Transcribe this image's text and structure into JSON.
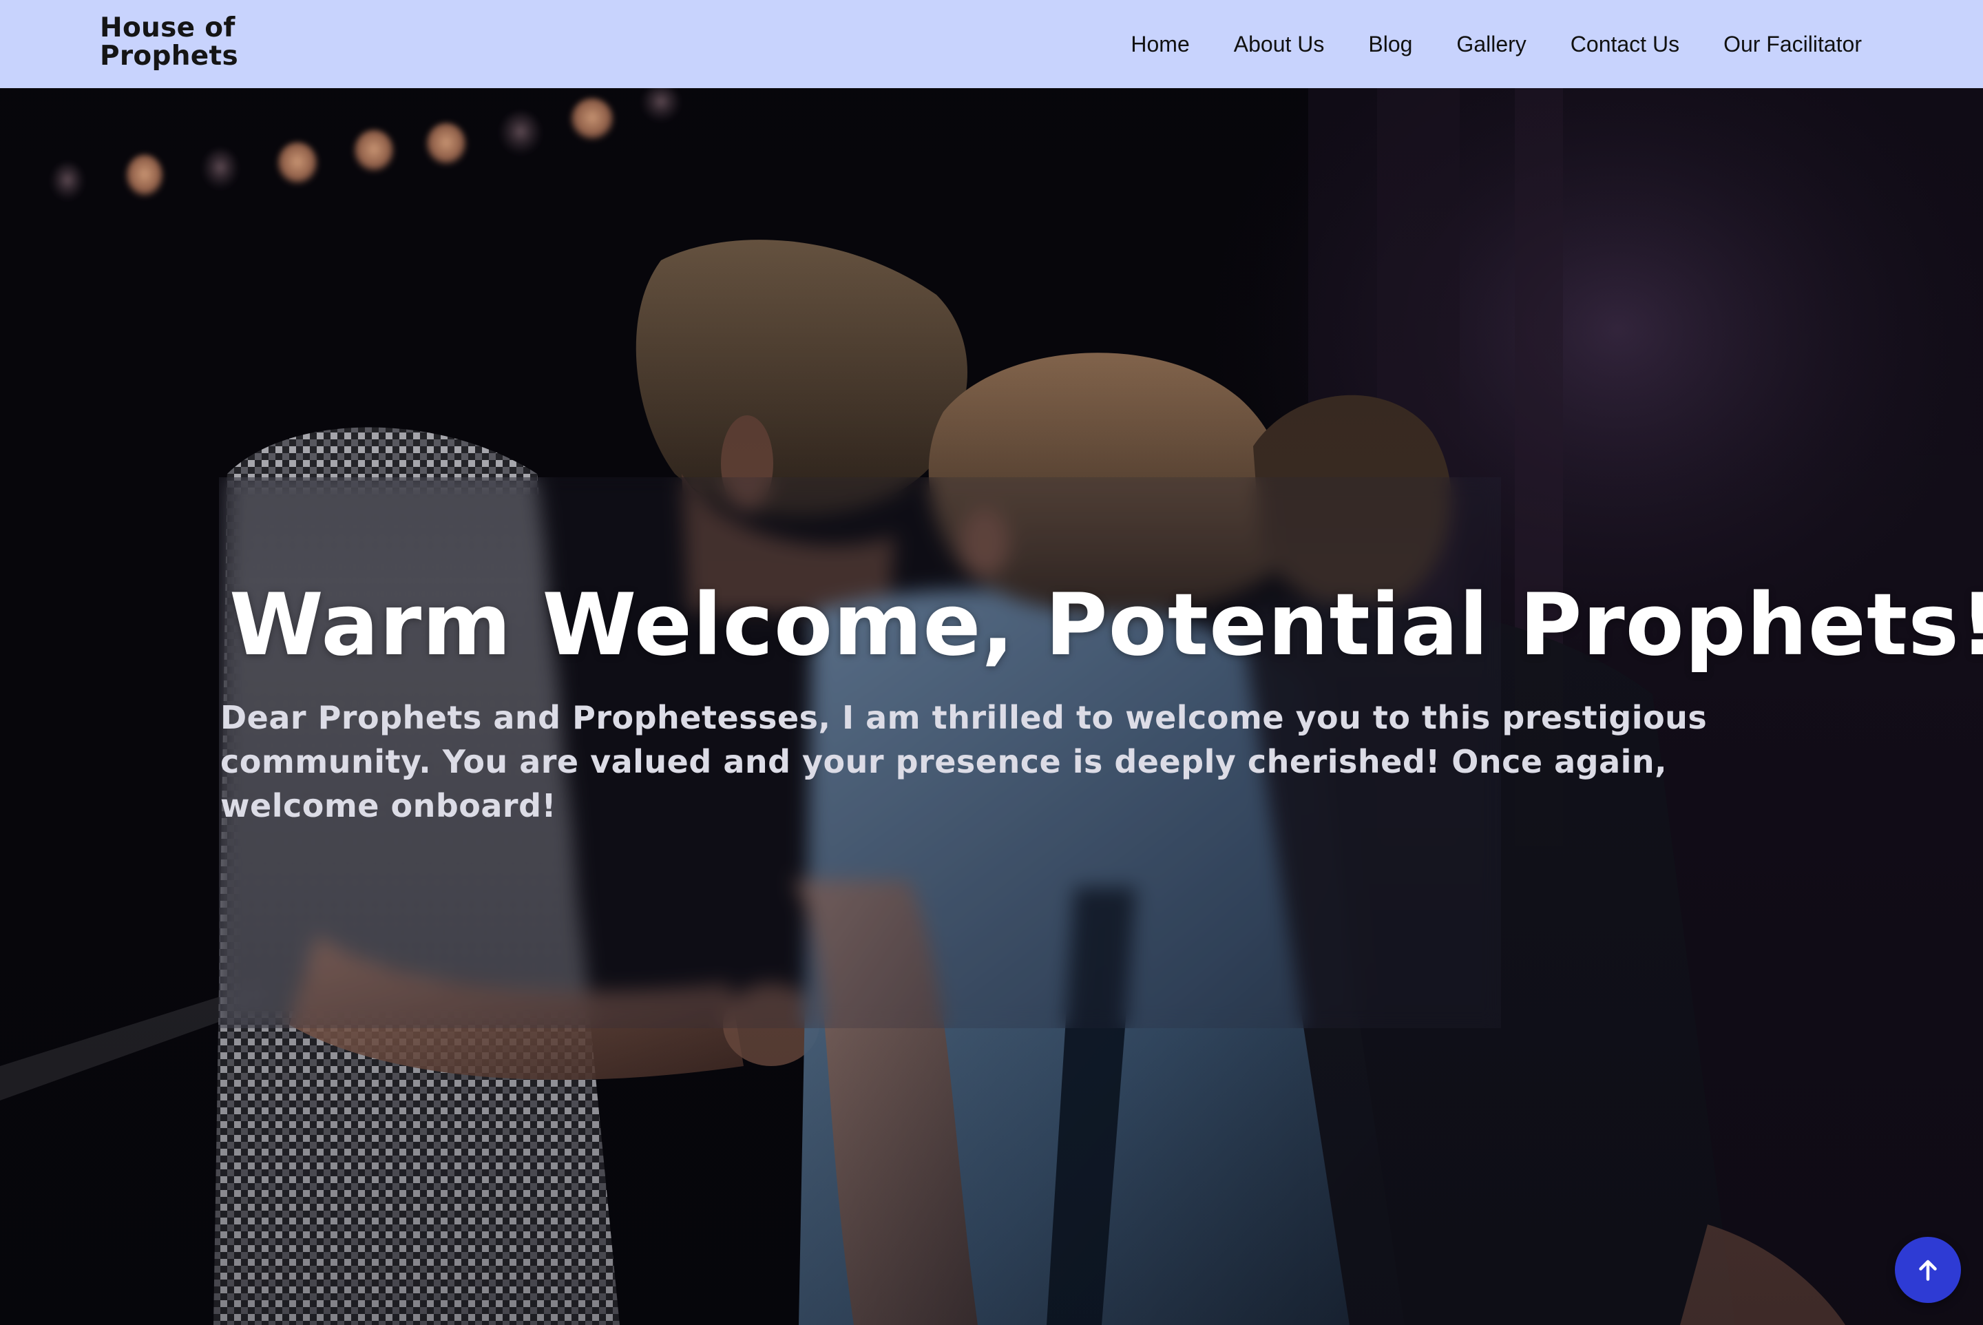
{
  "brand": {
    "name_line1": "House of",
    "name_line2": "Prophets"
  },
  "nav": {
    "items": [
      {
        "label": "Home"
      },
      {
        "label": "About Us"
      },
      {
        "label": "Blog"
      },
      {
        "label": "Gallery"
      },
      {
        "label": "Contact Us"
      },
      {
        "label": "Our Facilitator"
      }
    ]
  },
  "hero": {
    "title": "Warm Welcome, Potential Prophets!",
    "text": "Dear Prophets and Prophetesses, I am thrilled to welcome you to this prestigious community. You are valued and your presence is deeply cherished! Once again, welcome onboard!"
  },
  "scroll_top": {
    "icon": "arrow-up-icon"
  },
  "colors": {
    "navbar_bg": "#c8d3fd",
    "scroll_button": "#2e3bd4",
    "title": "#ffffff",
    "text": "#dcdce6"
  }
}
